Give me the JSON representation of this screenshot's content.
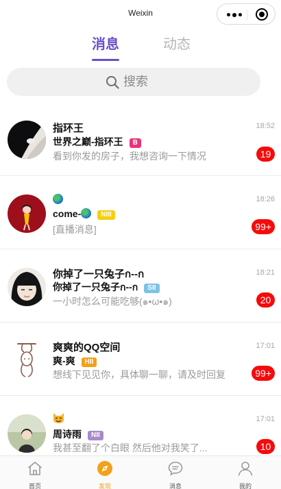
{
  "app": {
    "title": "Weixin"
  },
  "tabs": [
    {
      "label": "消息",
      "active": true
    },
    {
      "label": "动态",
      "active": false
    }
  ],
  "search": {
    "placeholder": "搜索"
  },
  "conversations": [
    {
      "title": "指环王",
      "name": "世界之巅-指环王",
      "badge": "B",
      "badge_color": "#e8357a",
      "preview": "看到你发的房子，我想咨询一下情况",
      "time": "18:52",
      "count": "19"
    },
    {
      "title": "",
      "name": "come-",
      "badge": "NIII",
      "badge_color": "#f5cf10",
      "preview": "[直播消息]",
      "time": "18:26",
      "count": "99+"
    },
    {
      "title": "你掉了一只兔子ก--ก",
      "name": "你掉了一只兔子ก--ก",
      "badge": "SII",
      "badge_color": "#7cc3e6",
      "preview": "一小时怎么可能吃够(๑•ω•๑)",
      "time": "18:21",
      "count": "20"
    },
    {
      "title": "爽爽的QQ空间",
      "name": "爽-爽",
      "badge": "HII",
      "badge_color": "#f2a11a",
      "preview": "想线下见见你，具体聊一聊，请及时回复",
      "time": "17:01",
      "count": "99+"
    },
    {
      "title": "",
      "name": "周诗雨",
      "badge": "NII",
      "badge_color": "#a78bc6",
      "preview": "我甚至翻了个白眼 然后他对我笑了...",
      "time": "17:01",
      "count": "10"
    }
  ],
  "bottom_nav": [
    {
      "label": "首页",
      "icon": "home-icon",
      "active": false
    },
    {
      "label": "发现",
      "icon": "compass-icon",
      "active": true
    },
    {
      "label": "消息",
      "icon": "chat-icon",
      "active": false
    },
    {
      "label": "我的",
      "icon": "user-icon",
      "active": false
    }
  ],
  "colors": {
    "accent": "#6a4fc8",
    "count_badge": "#f50b0b",
    "nav_active": "#f2a11a"
  }
}
